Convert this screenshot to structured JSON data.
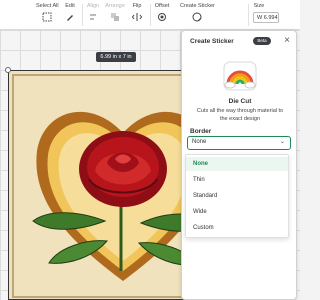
{
  "toolbar": {
    "items": [
      {
        "label": "Select All",
        "icon": "select-all-icon"
      },
      {
        "label": "Edit",
        "icon": "edit-icon"
      },
      {
        "label": "Align",
        "icon": "align-icon"
      },
      {
        "label": "Arrange",
        "icon": "arrange-icon"
      },
      {
        "label": "Flip",
        "icon": "flip-icon"
      },
      {
        "label": "Offset",
        "icon": "offset-icon"
      },
      {
        "label": "Create Sticker",
        "icon": "create-sticker-icon"
      },
      {
        "label": "Size",
        "icon": "size-icon"
      }
    ],
    "size_w_label": "W",
    "size_value": "6.994"
  },
  "canvas": {
    "dimension_label": "6.99  in x 7  in"
  },
  "panel": {
    "title": "Create Sticker",
    "beta_badge": "Beta",
    "close_icon": "close-icon",
    "die_cut_title": "Die Cut",
    "die_cut_description": "Cuts all the way through material to the exact design",
    "border_label": "Border",
    "border_selected": "None",
    "border_options": [
      "None",
      "Thin",
      "Standard",
      "Wide",
      "Custom"
    ]
  },
  "colors": {
    "accent": "#1f8a56",
    "dark_badge": "#3b3f44",
    "rose": "#b8141c",
    "heart_border": "#d9a23a",
    "leaf": "#3f7a2a"
  }
}
